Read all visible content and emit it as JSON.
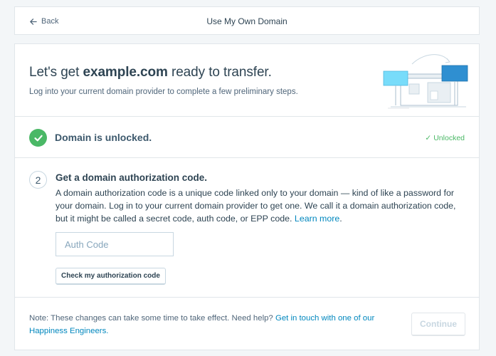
{
  "header": {
    "back_label": "Back",
    "title": "Use My Own Domain"
  },
  "intro": {
    "title_prefix": "Let's get ",
    "domain": "example.com",
    "title_suffix": " ready to transfer.",
    "subtitle": "Log into your current domain provider to complete a few preliminary steps."
  },
  "step_unlocked": {
    "label": "Domain is unlocked.",
    "status_icon": "✓",
    "status": "Unlocked"
  },
  "step_auth": {
    "number": "2",
    "title": "Get a domain authorization code.",
    "description": "A domain authorization code is a unique code linked only to your domain — kind of like a password for your domain. Log in to your current domain provider to get one. We call it a domain authorization code, but it might be called a secret code, auth code, or EPP code.",
    "learn_more": "Learn more",
    "learn_more_suffix": ".",
    "input_placeholder": "Auth Code",
    "input_value": "",
    "check_button": "Check my authorization code"
  },
  "footer": {
    "note": "Note: These changes can take some time to take effect. Need help?",
    "help_link": "Get in touch with one of our Happiness Engineers.",
    "continue_button": "Continue"
  },
  "colors": {
    "accent": "#0087be",
    "success": "#4ab866",
    "text": "#2e4453",
    "border": "#c8d7e1"
  },
  "icons": {
    "back": "arrow-left-icon",
    "unlocked": "checkmark-circle-icon",
    "status": "checkmark-icon",
    "illustration": "domain-transfer-illustration"
  }
}
